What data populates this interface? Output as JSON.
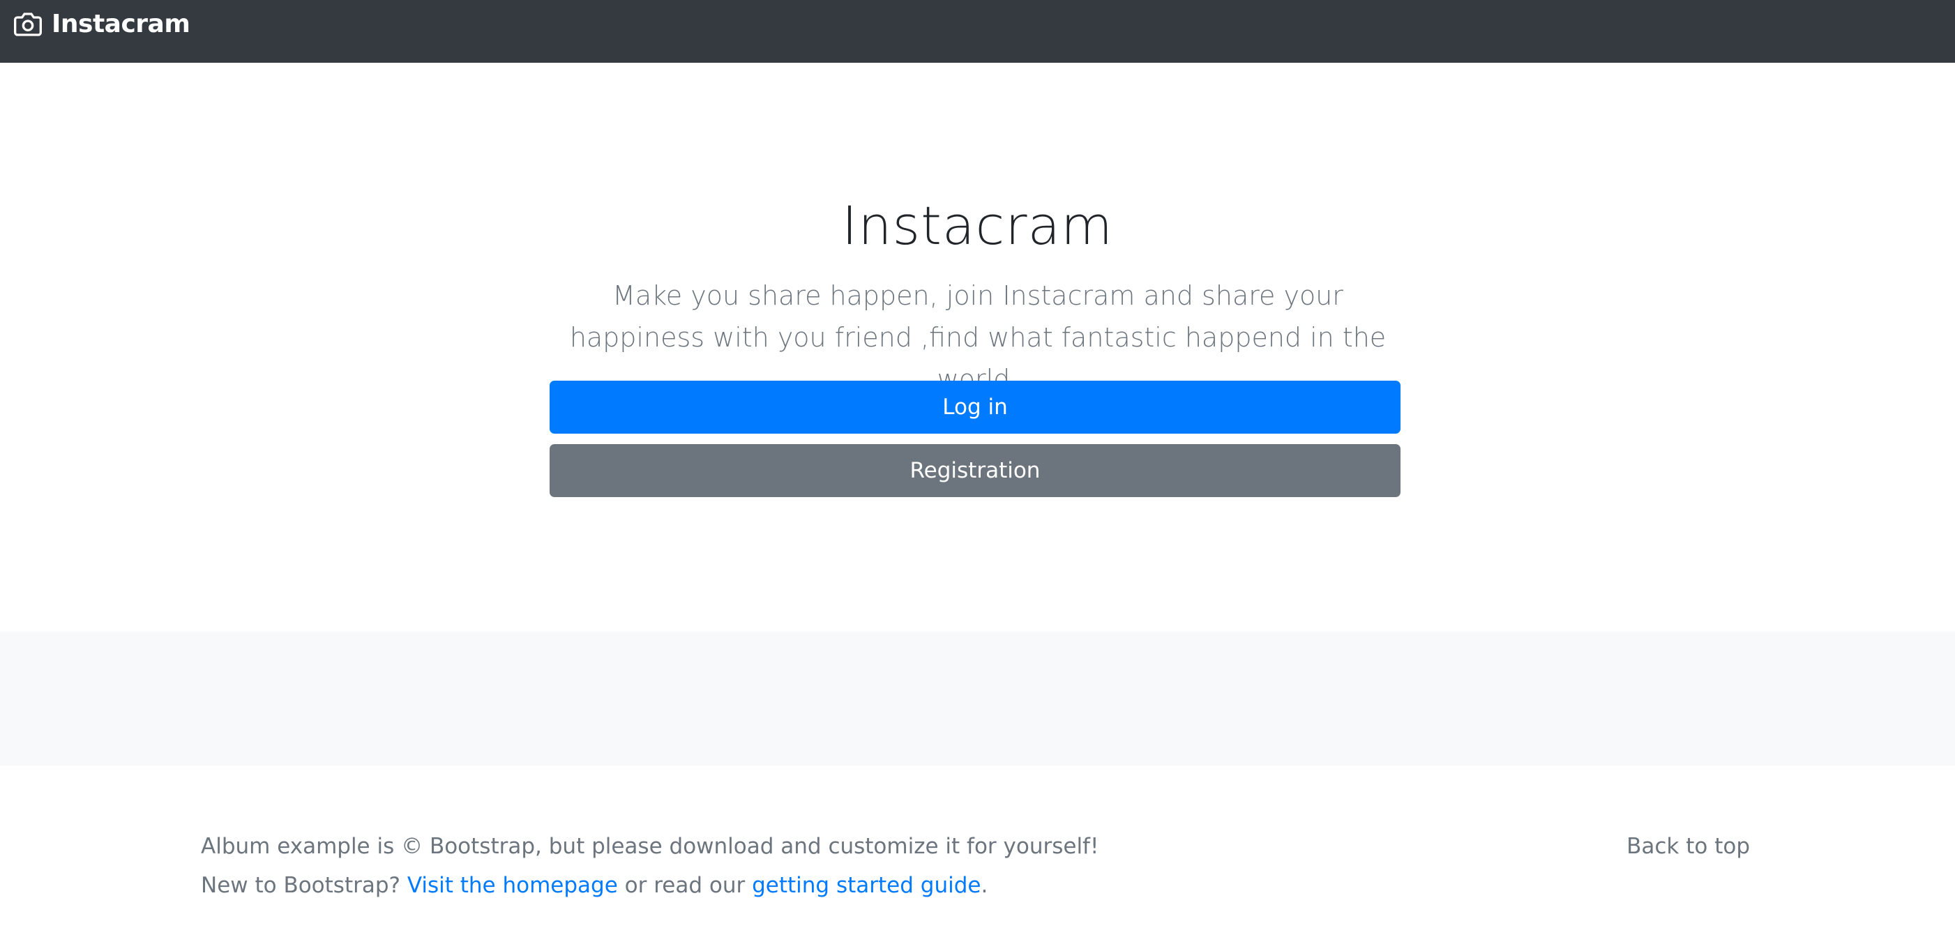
{
  "navbar": {
    "brand_icon": "camera-icon",
    "brand_text": "Instacram",
    "background": "#343a40"
  },
  "hero": {
    "title": "Instacram",
    "lead": "Make you share happen, join Instacram and share your happiness with you friend ,find what fantastic happend in the world.",
    "login_label": "Log in",
    "register_label": "Registration"
  },
  "footer": {
    "copyright_text": "Album example is © Bootstrap, but please download and customize it for yourself!",
    "new_to_text": "New to Bootstrap?",
    "homepage_link": "Visit the homepage",
    "or_read_text": "or read our",
    "guide_link": "getting started guide",
    "period": ".",
    "back_to_top": "Back to top"
  },
  "colors": {
    "primary": "#007bff",
    "secondary": "#6c757d",
    "light_bg": "#f8f9fa",
    "dark_nav": "#343a40"
  }
}
